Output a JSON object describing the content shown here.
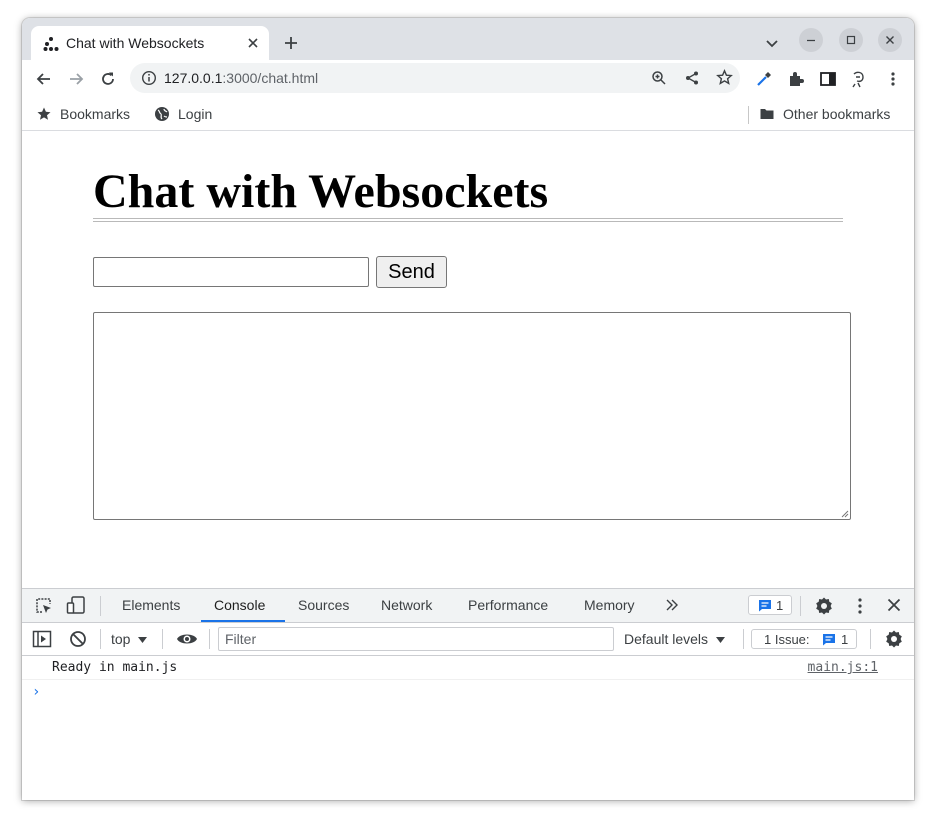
{
  "browser": {
    "tab": {
      "title": "Chat with Websockets"
    },
    "address": {
      "host": "127.0.0.1",
      "path": ":3000/chat.html"
    },
    "bookmarks": [
      {
        "label": "Bookmarks",
        "icon": "star-icon"
      },
      {
        "label": "Login",
        "icon": "globe-icon"
      }
    ],
    "other_bookmarks": "Other bookmarks"
  },
  "page": {
    "heading": "Chat with Websockets",
    "message_input": {
      "value": "",
      "placeholder": ""
    },
    "send_label": "Send",
    "chat_log": ""
  },
  "devtools": {
    "tabs": [
      "Elements",
      "Console",
      "Sources",
      "Network",
      "Performance",
      "Memory"
    ],
    "active_tab": "Console",
    "messages_badge": "1",
    "context": "top",
    "filter_placeholder": "Filter",
    "levels": "Default levels",
    "issues_label": "1 Issue:",
    "issues_count": "1",
    "log": [
      {
        "text": "Ready in main.js",
        "source": "main.js:1"
      }
    ],
    "prompt": "›"
  },
  "colors": {
    "accent": "#1a73e8",
    "tabstrip": "#dee1e6"
  }
}
